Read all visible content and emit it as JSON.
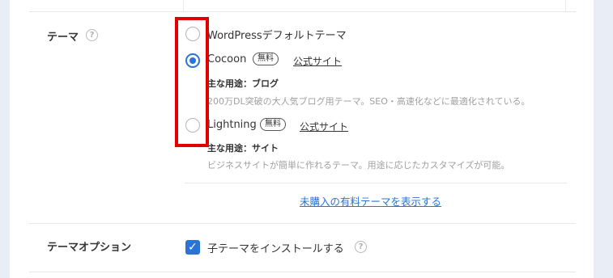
{
  "theme_section": {
    "label": "テーマ",
    "help_icon": "question-circle-icon",
    "help_glyph": "?",
    "options": [
      {
        "name": "WordPressデフォルトテーマ",
        "selected": false
      },
      {
        "name": "Cocoon",
        "badge": "無料",
        "site_link": "公式サイト",
        "usage": "主な用途：ブログ",
        "description": "200万DL突破の大人気ブログ用テーマ。SEO・高速化などに最適化されている。",
        "selected": true
      },
      {
        "name": "Lightning",
        "badge": "無料",
        "site_link": "公式サイト",
        "usage": "主な用途：サイト",
        "description": "ビジネスサイトが簡単に作れるテーマ。用途に応じたカスタマイズが可能。",
        "selected": false
      }
    ],
    "show_paid_link": "未購入の有料テーマを表示する"
  },
  "theme_option_section": {
    "label": "テーマオプション",
    "checkbox_label": "子テーマをインストールする",
    "checkbox_checked": true,
    "check_glyph": "✓",
    "help_glyph": "?"
  },
  "colors": {
    "accent": "#2a74d6",
    "highlight_box": "#e00000"
  }
}
